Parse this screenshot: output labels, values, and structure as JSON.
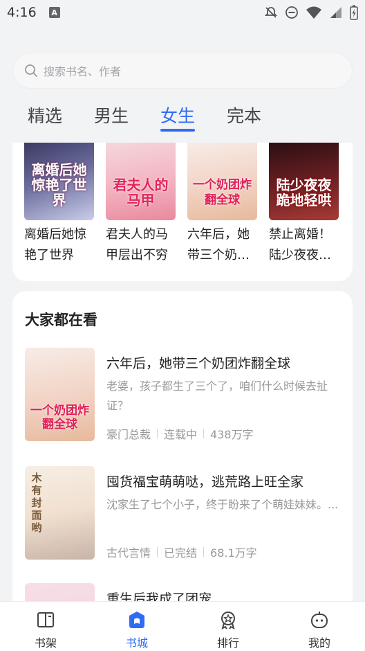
{
  "status": {
    "time": "4:16",
    "a_badge": "A",
    "icons": [
      "a-badge-icon",
      "dnd-off-icon",
      "minus-circle-icon",
      "wifi-icon",
      "signal-icon",
      "battery-charging-icon"
    ]
  },
  "search": {
    "placeholder": "搜索书名、作者",
    "icon": "search-icon"
  },
  "tabs": [
    {
      "label": "精选",
      "active": false
    },
    {
      "label": "男生",
      "active": false
    },
    {
      "label": "女生",
      "active": true
    },
    {
      "label": "完本",
      "active": false
    }
  ],
  "grid_books": [
    {
      "title": "离婚后她惊艳了世界",
      "cover_text": "离婚后她惊艳了世界"
    },
    {
      "title": "君夫人的马甲层出不穷",
      "cover_text": "君夫人的马甲"
    },
    {
      "title": "六年后，她带三个奶团炸翻全球",
      "cover_text": "一个奶团炸翻全球"
    },
    {
      "title": "禁止离婚！陆少夜夜跪地轻哄",
      "cover_text": "陆少夜夜跪地轻哄"
    }
  ],
  "popular": {
    "title": "大家都在看",
    "items": [
      {
        "title": "六年后，她带三个奶团炸翻全球",
        "desc": "老婆，孩子都生了三个了，咱们什么时候去扯证？",
        "tags": [
          "豪门总裁",
          "连载中",
          "438万字"
        ],
        "cover_text": "一个奶团炸翻全球"
      },
      {
        "title": "囤货福宝萌萌哒，逃荒路上旺全家",
        "desc": "沈家生了七个小子，终于盼来了个萌娃妹妹。...",
        "tags": [
          "古代言情",
          "已完结",
          "68.1万字"
        ],
        "cover_text": "木有封面哟"
      },
      {
        "title": "重生后我成了团宠",
        "desc": "",
        "tags": [],
        "cover_text": ""
      }
    ]
  },
  "bottom_nav": [
    {
      "label": "书架",
      "icon": "bookshelf-icon",
      "active": false
    },
    {
      "label": "书城",
      "icon": "bookstore-icon",
      "active": true
    },
    {
      "label": "排行",
      "icon": "ranking-icon",
      "active": false
    },
    {
      "label": "我的",
      "icon": "profile-icon",
      "active": false
    }
  ],
  "colors": {
    "accent": "#2f6cf6",
    "background": "#f2f3f5",
    "card": "#ffffff",
    "muted_text": "#999999"
  }
}
